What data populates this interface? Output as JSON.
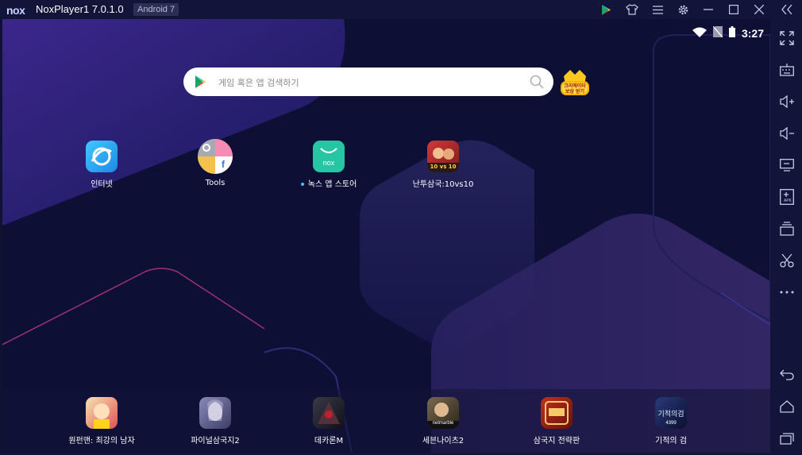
{
  "window": {
    "logo": "nox",
    "title": "NoxPlayer1 7.0.1.0",
    "android_badge": "Android 7"
  },
  "titlebar_icons": [
    "play-store-icon",
    "shirt-icon",
    "menu-icon",
    "gear-icon",
    "minimize-icon",
    "maximize-icon",
    "close-icon",
    "collapse-icon"
  ],
  "status_bar": {
    "clock": "3:27",
    "icons": [
      "wifi-icon",
      "no-sim-icon",
      "battery-icon"
    ]
  },
  "search": {
    "placeholder": "게임 혹은 앱 검색하기"
  },
  "promo": {
    "line1": "크리에이터",
    "line2": "보상 받기"
  },
  "desktop_apps": [
    {
      "label": "인터넷",
      "icon": "browser-icon"
    },
    {
      "label": "Tools",
      "icon": "tools-icon"
    },
    {
      "label": "녹스 앱 스토어",
      "icon": "nox-store-icon"
    },
    {
      "label": "난투삼국:10vs10",
      "icon": "game-icon"
    }
  ],
  "nox_store_icon_text": "nox",
  "game_badge": "10 vs 10",
  "dock_apps": [
    {
      "label": "원펀맨: 최강의 남자",
      "icon": "onepunch-icon"
    },
    {
      "label": "파이널삼국지2",
      "icon": "final-three-kingdoms-icon"
    },
    {
      "label": "데카론M",
      "icon": "dekaron-icon"
    },
    {
      "label": "세븐나이츠2",
      "icon": "seven-knights-icon",
      "badge": "netmarble"
    },
    {
      "label": "삼국지 전략판",
      "icon": "three-kingdoms-strategy-icon"
    },
    {
      "label": "기적의 검",
      "icon": "miracle-sword-icon",
      "badge": "4399",
      "title": "기적의검"
    }
  ],
  "sidebar_icons": [
    "fullscreen-icon",
    "keyboard-icon",
    "volume-up-icon",
    "volume-down-icon",
    "screen-icon",
    "apk-install-icon",
    "multi-instance-icon",
    "scissors-icon",
    "more-icon",
    "back-icon",
    "home-icon",
    "recent-apps-icon"
  ],
  "sidebar_apk_label": "APK",
  "colors": {
    "titlebar_bg": "#12143a",
    "screen_bg": "#0d0f35",
    "accent": "#3ec1ef"
  }
}
